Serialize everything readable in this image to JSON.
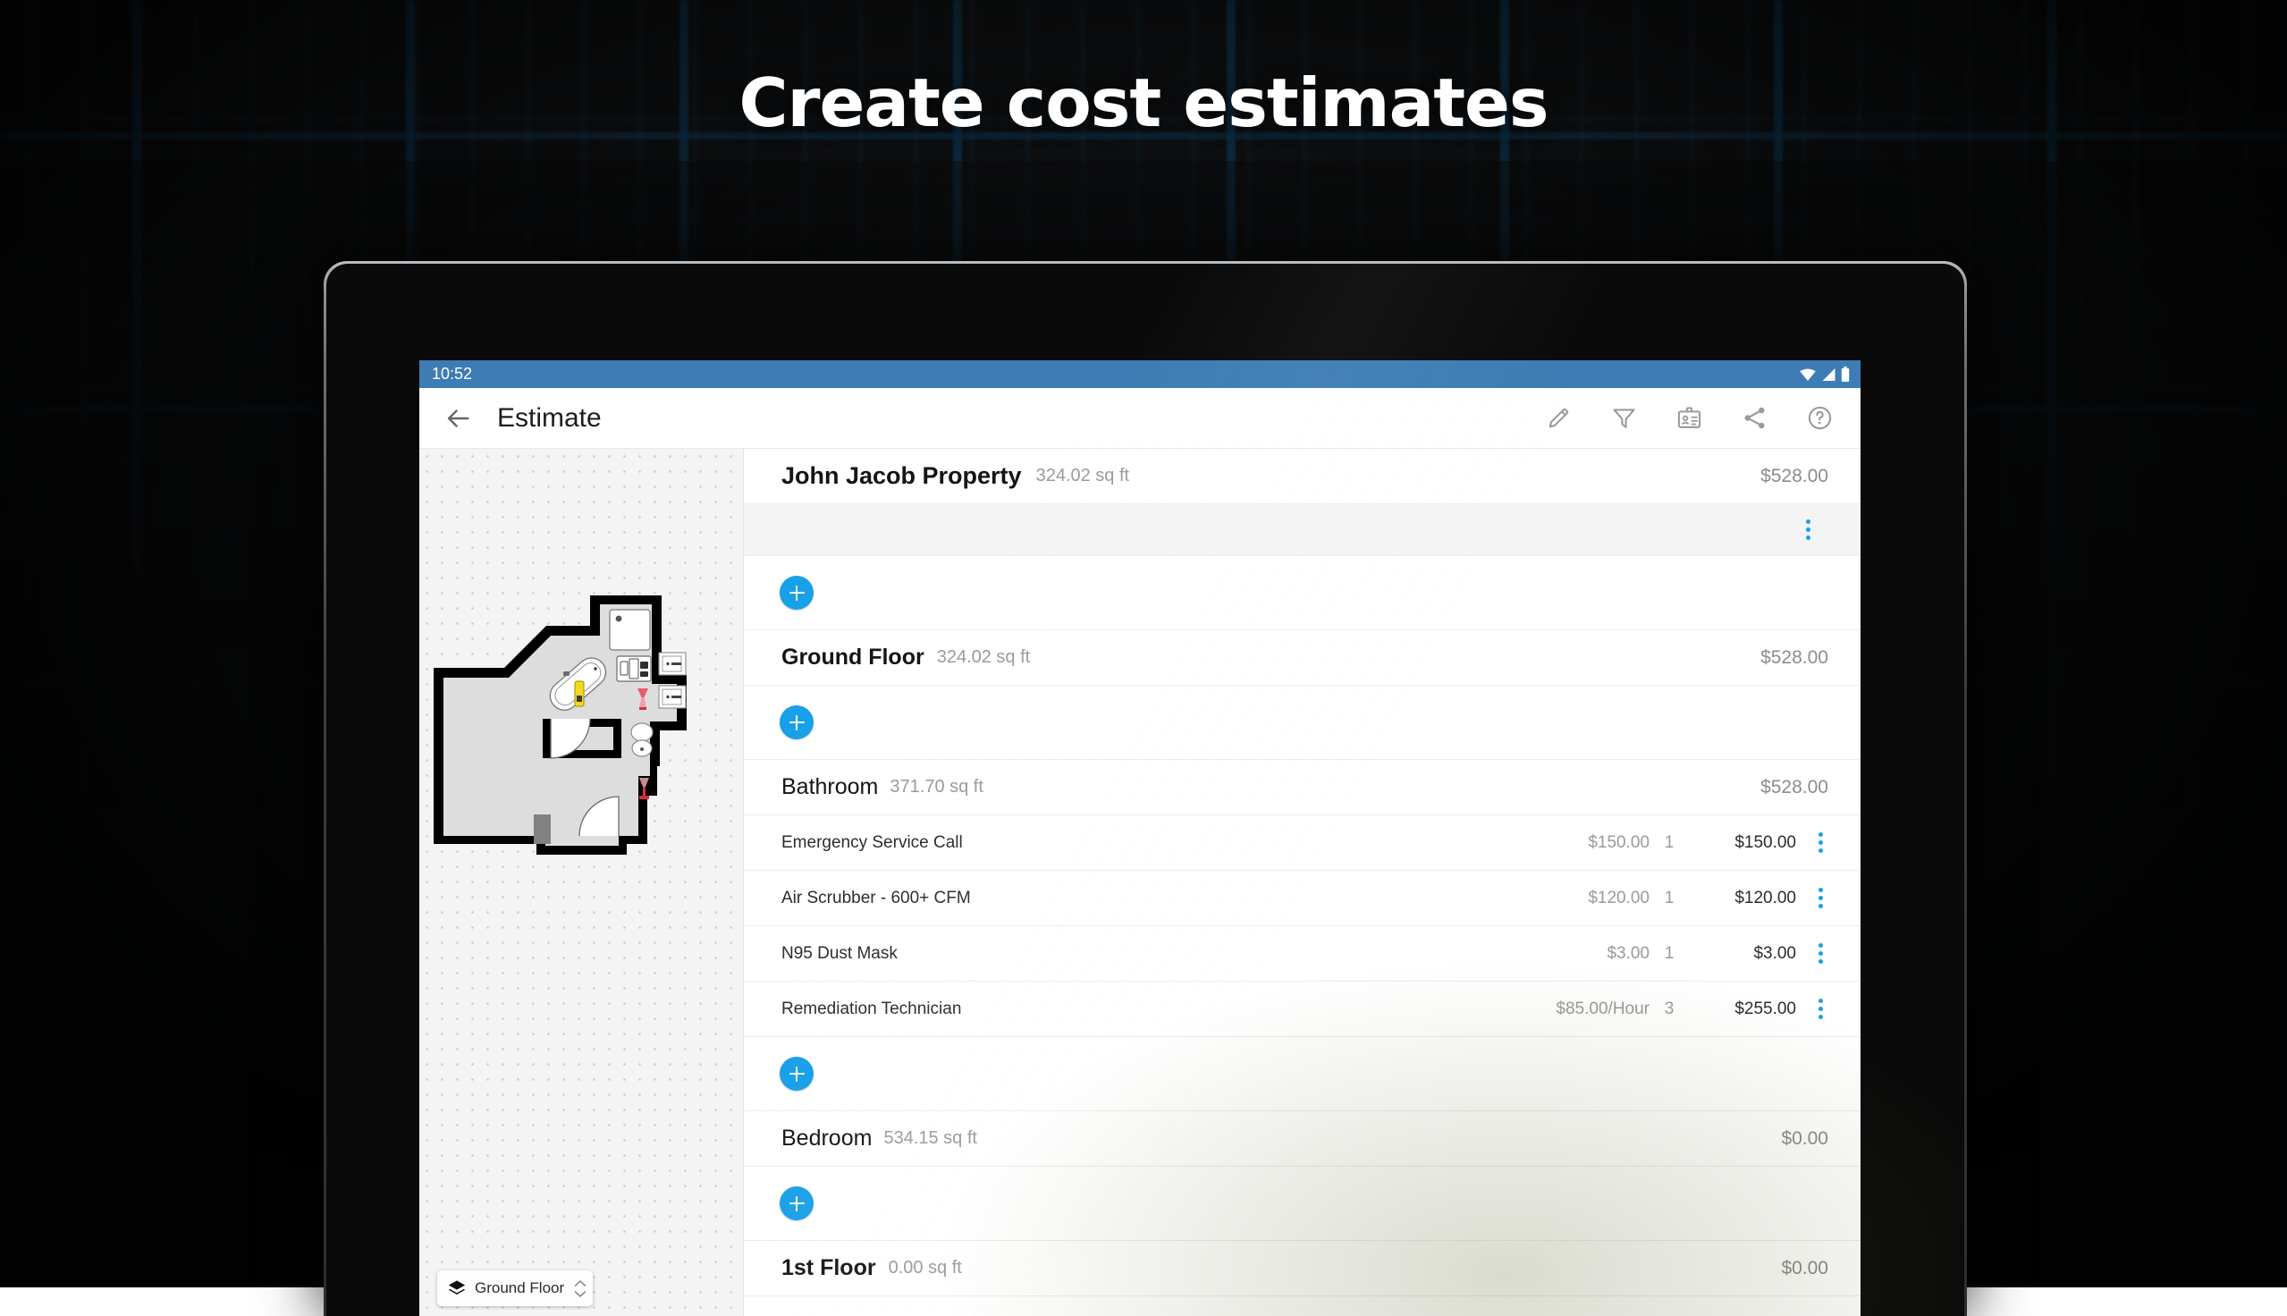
{
  "promo": {
    "headline": "Create cost estimates"
  },
  "device": {
    "status_bar": {
      "time": "10:52",
      "icons": [
        "wifi-icon",
        "cellular-signal-icon",
        "battery-icon"
      ]
    }
  },
  "app_bar": {
    "back_icon": "back-arrow-icon",
    "title": "Estimate",
    "actions": [
      {
        "name": "edit-icon",
        "label": "Edit"
      },
      {
        "name": "filter-icon",
        "label": "Filter"
      },
      {
        "name": "badge-icon",
        "label": "Contact"
      },
      {
        "name": "share-icon",
        "label": "Share"
      },
      {
        "name": "help-icon",
        "label": "Help"
      }
    ]
  },
  "plan_panel": {
    "floor_selector": {
      "icon": "layers-icon",
      "label": "Ground Floor",
      "stepper_up": "chevron-up-icon",
      "stepper_down": "chevron-down-icon"
    }
  },
  "estimate": {
    "property": {
      "name": "John Jacob Property",
      "area": "324.02 sq ft",
      "total": "$528.00"
    },
    "add_label": "+",
    "sections": [
      {
        "type": "floor",
        "name": "Ground Floor",
        "area": "324.02 sq ft",
        "total": "$528.00"
      },
      {
        "type": "room",
        "name": "Bathroom",
        "area": "371.70 sq ft",
        "total": "$528.00",
        "items": [
          {
            "desc": "Emergency Service Call",
            "rate": "$150.00",
            "qty": "1",
            "amount": "$150.00"
          },
          {
            "desc": "Air Scrubber - 600+ CFM",
            "rate": "$120.00",
            "qty": "1",
            "amount": "$120.00"
          },
          {
            "desc": "N95 Dust Mask",
            "rate": "$3.00",
            "qty": "1",
            "amount": "$3.00"
          },
          {
            "desc": "Remediation Technician",
            "rate": "$85.00/Hour",
            "qty": "3",
            "amount": "$255.00"
          }
        ]
      },
      {
        "type": "room",
        "name": "Bedroom",
        "area": "534.15 sq ft",
        "total": "$0.00",
        "items": []
      },
      {
        "type": "floor",
        "name": "1st Floor",
        "area": "0.00 sq ft",
        "total": "$0.00"
      }
    ]
  },
  "colors": {
    "accent": "#18a0e8",
    "status_bar": "#3d7cb4",
    "text_primary": "#151515",
    "text_muted": "#9a9a9a"
  }
}
